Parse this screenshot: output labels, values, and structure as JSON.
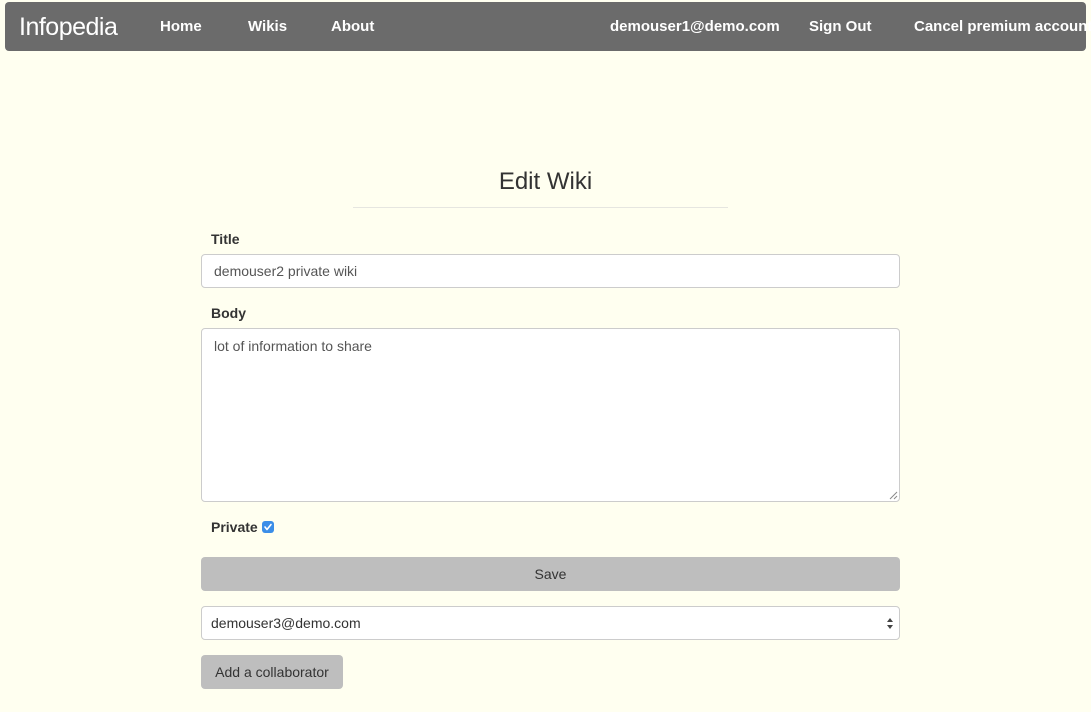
{
  "navbar": {
    "brand": "Infopedia",
    "links": [
      "Home",
      "Wikis",
      "About"
    ],
    "user_email": "demouser1@demo.com",
    "sign_out": "Sign Out",
    "cancel_premium": "Cancel premium account"
  },
  "page": {
    "heading": "Edit Wiki"
  },
  "form": {
    "title_label": "Title",
    "title_value": "demouser2 private wiki",
    "body_label": "Body",
    "body_value": "lot of information to share",
    "private_label": "Private",
    "private_checked": true,
    "save_label": "Save",
    "collaborator_selected": "demouser3@demo.com",
    "add_collaborator_label": "Add a collaborator"
  },
  "colors": {
    "background": "#fffff0",
    "navbar": "#6b6b6b",
    "button": "#bebebe",
    "checkbox": "#3b8ee8"
  }
}
